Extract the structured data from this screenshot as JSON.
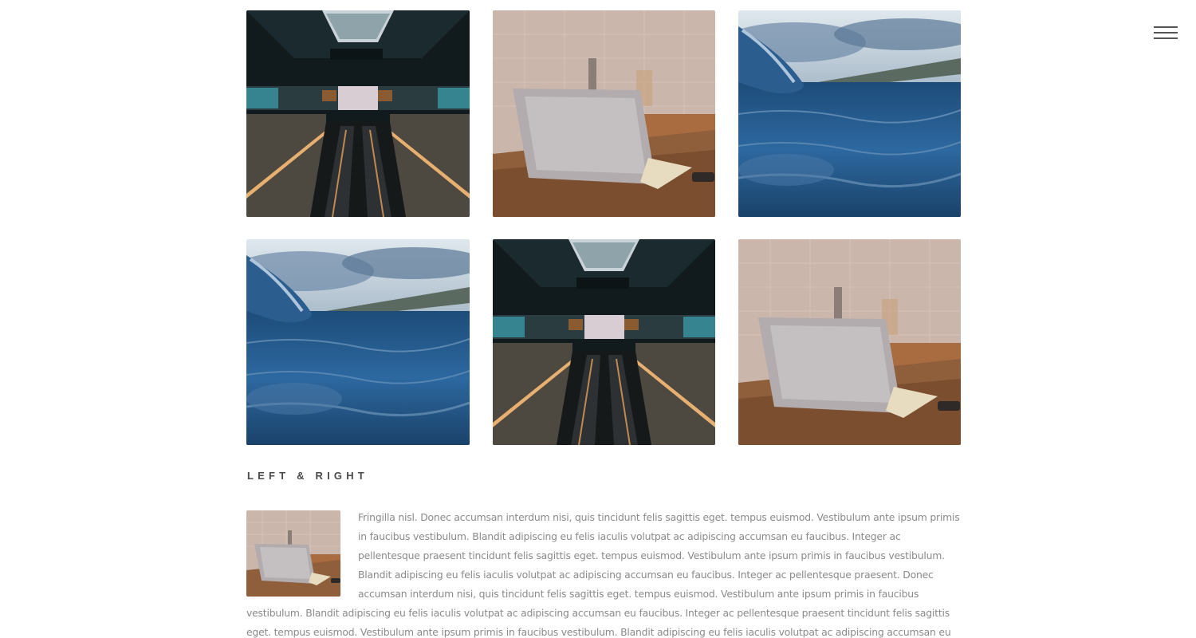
{
  "nav": {
    "menu_icon": "hamburger-menu-icon"
  },
  "gallery": {
    "images": [
      {
        "subject": "escalator",
        "label": "escalator-image"
      },
      {
        "subject": "laptop",
        "label": "laptop-image"
      },
      {
        "subject": "wave",
        "label": "wave-image"
      },
      {
        "subject": "wave",
        "label": "wave-image"
      },
      {
        "subject": "escalator",
        "label": "escalator-image"
      },
      {
        "subject": "laptop",
        "label": "laptop-image"
      }
    ]
  },
  "section": {
    "heading": "LEFT & RIGHT",
    "thumbnail_subject": "laptop",
    "body": "Fringilla nisl. Donec accumsan interdum nisi, quis tincidunt felis sagittis eget. tempus euismod. Vestibulum ante ipsum primis in faucibus vestibulum. Blandit adipiscing eu felis iaculis volutpat ac adipiscing accumsan eu faucibus. Integer ac pellentesque praesent tincidunt felis sagittis eget. tempus euismod. Vestibulum ante ipsum primis in faucibus vestibulum. Blandit adipiscing eu felis iaculis volutpat ac adipiscing accumsan eu faucibus. Integer ac pellentesque praesent. Donec accumsan interdum nisi, quis tincidunt felis sagittis eget. tempus euismod. Vestibulum ante ipsum primis in faucibus vestibulum. Blandit adipiscing eu felis iaculis volutpat ac adipiscing accumsan eu faucibus. Integer ac pellentesque praesent tincidunt felis sagittis eget. tempus euismod. Vestibulum ante ipsum primis in faucibus vestibulum. Blandit adipiscing eu felis iaculis volutpat ac adipiscing accumsan eu faucibus. Integer ac pellentesque"
  },
  "colors": {
    "heading": "#4a4a4a",
    "body_text": "#8a8a8a",
    "menu_bars": "#555555"
  }
}
